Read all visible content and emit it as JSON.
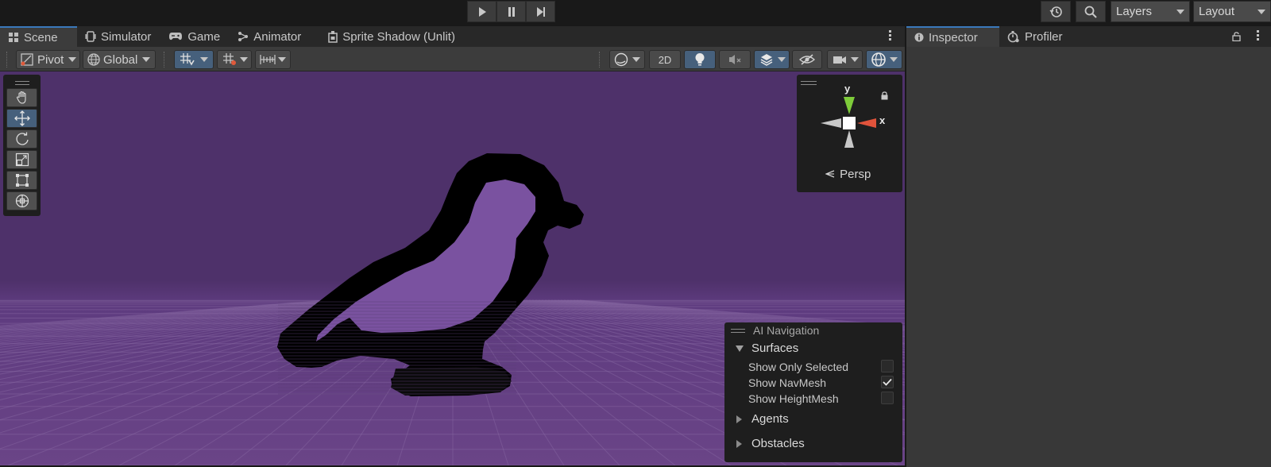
{
  "toolbar": {
    "play_icon": "play-icon",
    "pause_icon": "pause-icon",
    "step_icon": "step-icon",
    "history_icon": "history-icon",
    "search_icon": "search-icon",
    "layers_label": "Layers",
    "layout_label": "Layout"
  },
  "scene_tabs": {
    "scene": "Scene",
    "simulator": "Simulator",
    "game": "Game",
    "animator": "Animator",
    "sprite_shadow": "Sprite Shadow (Unlit)"
  },
  "inspector_tabs": {
    "inspector": "Inspector",
    "profiler": "Profiler"
  },
  "scene_toolbar": {
    "pivot_label": "Pivot",
    "global_label": "Global",
    "mode_2d_label": "2D"
  },
  "tools": [
    "hand-tool-icon",
    "move-tool-icon",
    "rotate-tool-icon",
    "scale-tool-icon",
    "rect-tool-icon",
    "transform-tool-icon"
  ],
  "gizmo": {
    "y_label": "y",
    "x_label": "x",
    "projection_label": "Persp",
    "colors": {
      "x": "#e0533b",
      "y": "#7ecc3a",
      "neutral": "#c8c8c8"
    }
  },
  "ai_navigation": {
    "title": "AI Navigation",
    "surfaces_label": "Surfaces",
    "show_only_selected_label": "Show Only Selected",
    "show_only_selected": false,
    "show_navmesh_label": "Show NavMesh",
    "show_navmesh": true,
    "show_heightmesh_label": "Show HeightMesh",
    "show_heightmesh": false,
    "agents_label": "Agents",
    "obstacles_label": "Obstacles"
  },
  "colors": {
    "accent": "#3a79bb",
    "viewport_bg": "#4e316a",
    "bird_fill": "#7a52a0",
    "bird_outline": "#000000"
  }
}
